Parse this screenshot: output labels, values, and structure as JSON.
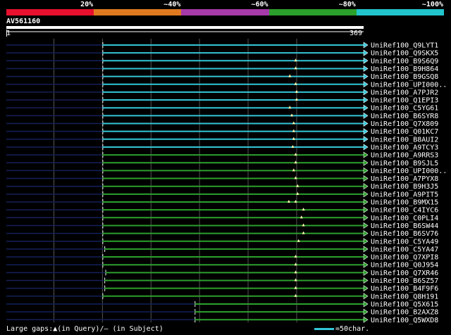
{
  "legend": {
    "segments": [
      {
        "color": "#e8102e"
      },
      {
        "color": "#e07a20"
      },
      {
        "color": "#a63aa8"
      },
      {
        "color": "#2ca02c"
      },
      {
        "color": "#22c5cc"
      }
    ],
    "labels": [
      "20%",
      "~40%",
      "~60%",
      "~80%",
      "~100%"
    ]
  },
  "query": {
    "id": "AV561160",
    "start": "1",
    "end": "369",
    "length": 369
  },
  "chart_data": {
    "type": "alignment-overview",
    "query_length": 369,
    "tick_positions": [
      50,
      100,
      150,
      200,
      250,
      300
    ],
    "colors": {
      "cyan": "#33c6d6",
      "green": "#2ca02c",
      "navy": "#15205a",
      "grid": "#555555",
      "gap": "#ffffb0"
    },
    "hits": [
      {
        "name": "UniRef100_Q9LYT1",
        "color": "cyan",
        "start": 100,
        "end": 369,
        "gaps": []
      },
      {
        "name": "UniRef100_Q9SKX5",
        "color": "cyan",
        "start": 100,
        "end": 369,
        "gaps": []
      },
      {
        "name": "UniRef100_B9S6Q9",
        "color": "cyan",
        "start": 100,
        "end": 369,
        "gaps": [
          299
        ]
      },
      {
        "name": "UniRef100_B9H864",
        "color": "cyan",
        "start": 100,
        "end": 369,
        "gaps": [
          299
        ]
      },
      {
        "name": "UniRef100_B9GSQ8",
        "color": "cyan",
        "start": 100,
        "end": 369,
        "gaps": [
          293
        ]
      },
      {
        "name": "UniRef100_UPI000..",
        "color": "cyan",
        "start": 100,
        "end": 369,
        "gaps": [
          299
        ]
      },
      {
        "name": "UniRef100_A7PJR2",
        "color": "cyan",
        "start": 100,
        "end": 369,
        "gaps": [
          300
        ]
      },
      {
        "name": "UniRef100_Q1EPI3",
        "color": "cyan",
        "start": 100,
        "end": 369,
        "gaps": [
          300
        ]
      },
      {
        "name": "UniRef100_C5YG61",
        "color": "cyan",
        "start": 100,
        "end": 369,
        "gaps": [
          293
        ]
      },
      {
        "name": "UniRef100_B6SYR8",
        "color": "cyan",
        "start": 100,
        "end": 369,
        "gaps": [
          295
        ]
      },
      {
        "name": "UniRef100_Q7X809",
        "color": "cyan",
        "start": 100,
        "end": 369,
        "gaps": [
          297
        ]
      },
      {
        "name": "UniRef100_Q01KC7",
        "color": "cyan",
        "start": 100,
        "end": 369,
        "gaps": [
          297
        ]
      },
      {
        "name": "UniRef100_B8AUI2",
        "color": "cyan",
        "start": 100,
        "end": 369,
        "gaps": [
          297
        ]
      },
      {
        "name": "UniRef100_A9TCY3",
        "color": "cyan",
        "start": 100,
        "end": 369,
        "gaps": [
          296
        ]
      },
      {
        "name": "UniRef100_A9RRS3",
        "color": "green",
        "start": 100,
        "end": 369,
        "gaps": [
          299
        ]
      },
      {
        "name": "UniRef100_B9SJL5",
        "color": "green",
        "start": 100,
        "end": 369,
        "gaps": [
          299
        ]
      },
      {
        "name": "UniRef100_UPI000..",
        "color": "green",
        "start": 100,
        "end": 369,
        "gaps": [
          297
        ]
      },
      {
        "name": "UniRef100_A7PYX8",
        "color": "green",
        "start": 100,
        "end": 369,
        "gaps": [
          299
        ]
      },
      {
        "name": "UniRef100_B9H3J5",
        "color": "green",
        "start": 100,
        "end": 369,
        "gaps": [
          301
        ]
      },
      {
        "name": "UniRef100_A9PIT5",
        "color": "green",
        "start": 100,
        "end": 369,
        "gaps": [
          301
        ]
      },
      {
        "name": "UniRef100_B9MX15",
        "color": "green",
        "start": 100,
        "end": 369,
        "gaps": [
          292,
          299
        ]
      },
      {
        "name": "UniRef100_C4IYC6",
        "color": "green",
        "start": 100,
        "end": 369,
        "gaps": [
          307
        ]
      },
      {
        "name": "UniRef100_C0PLI4",
        "color": "green",
        "start": 100,
        "end": 369,
        "gaps": [
          305
        ]
      },
      {
        "name": "UniRef100_B6SW44",
        "color": "green",
        "start": 100,
        "end": 369,
        "gaps": [
          307
        ]
      },
      {
        "name": "UniRef100_B6SV76",
        "color": "green",
        "start": 100,
        "end": 369,
        "gaps": [
          307
        ]
      },
      {
        "name": "UniRef100_C5YA49",
        "color": "green",
        "start": 100,
        "end": 369,
        "gaps": [
          302
        ]
      },
      {
        "name": "UniRef100_C5YA47",
        "color": "green",
        "start": 102,
        "end": 369,
        "gaps": []
      },
      {
        "name": "UniRef100_Q7XPI8",
        "color": "green",
        "start": 100,
        "end": 369,
        "gaps": [
          299
        ]
      },
      {
        "name": "UniRef100_Q0J954",
        "color": "green",
        "start": 100,
        "end": 369,
        "gaps": [
          299
        ]
      },
      {
        "name": "UniRef100_Q7XR46",
        "color": "green",
        "start": 103,
        "end": 369,
        "gaps": [
          299
        ]
      },
      {
        "name": "UniRef100_B6SZ57",
        "color": "green",
        "start": 102,
        "end": 369,
        "gaps": [
          299
        ]
      },
      {
        "name": "UniRef100_B4F9F6",
        "color": "green",
        "start": 102,
        "end": 369,
        "gaps": [
          299
        ]
      },
      {
        "name": "UniRef100_Q8H191",
        "color": "green",
        "start": 100,
        "end": 369,
        "gaps": [
          299
        ]
      },
      {
        "name": "UniRef100_Q5X615",
        "color": "green",
        "start": 195,
        "end": 369,
        "gaps": []
      },
      {
        "name": "UniRef100_B2AXZ8",
        "color": "green",
        "start": 195,
        "end": 369,
        "gaps": []
      },
      {
        "name": "UniRef100_Q5WXD8",
        "color": "green",
        "start": 195,
        "end": 369,
        "gaps": []
      }
    ]
  },
  "footer": {
    "gaps_text": "Large gaps:▲(in Query)/– (in Subject)",
    "scale_text": "=50char."
  }
}
